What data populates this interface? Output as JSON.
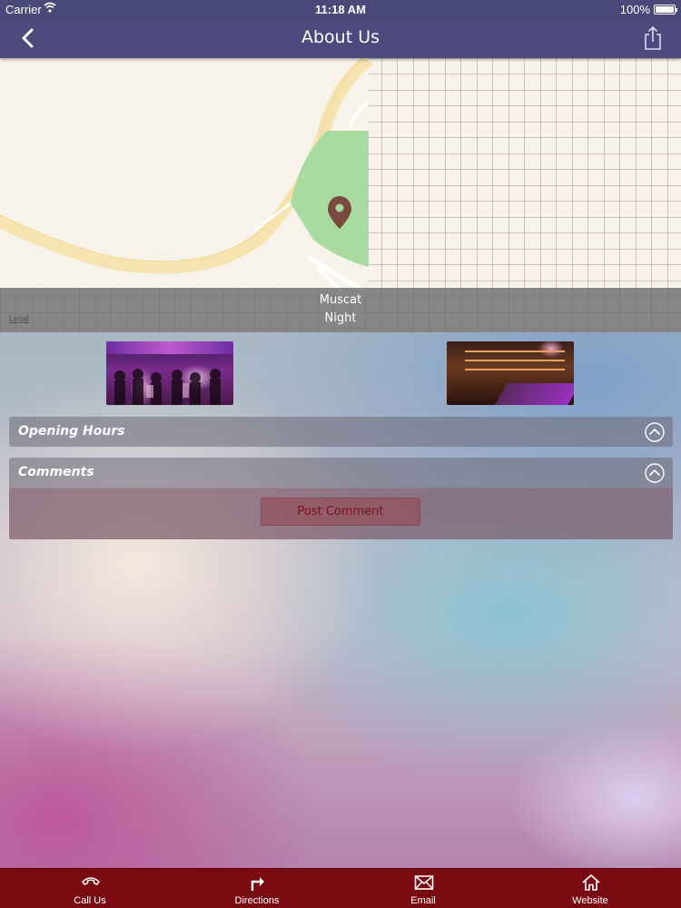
{
  "status_bar": {
    "carrier": "Carrier",
    "time": "11:18 AM",
    "battery": "100%"
  },
  "nav": {
    "title": "About Us",
    "back_icon": "chevron-left-icon",
    "share_icon": "share-icon"
  },
  "map": {
    "pin_label_line1": "Muscat",
    "pin_label_line2": "Night",
    "legal": "Legal",
    "pin_color": "#7a4a40"
  },
  "gallery": {
    "images": [
      "crowd-party-photo",
      "bar-interior-photo"
    ]
  },
  "sections": {
    "opening_hours": {
      "title": "Opening Hours"
    },
    "comments": {
      "title": "Comments",
      "post_button": "Post Comment"
    }
  },
  "tab_bar": {
    "color": "#7a0a12",
    "items": [
      {
        "label": "Call Us",
        "icon": "phone-icon"
      },
      {
        "label": "Directions",
        "icon": "directions-arrow-icon"
      },
      {
        "label": "Email",
        "icon": "envelope-icon"
      },
      {
        "label": "Website",
        "icon": "home-icon"
      }
    ]
  }
}
